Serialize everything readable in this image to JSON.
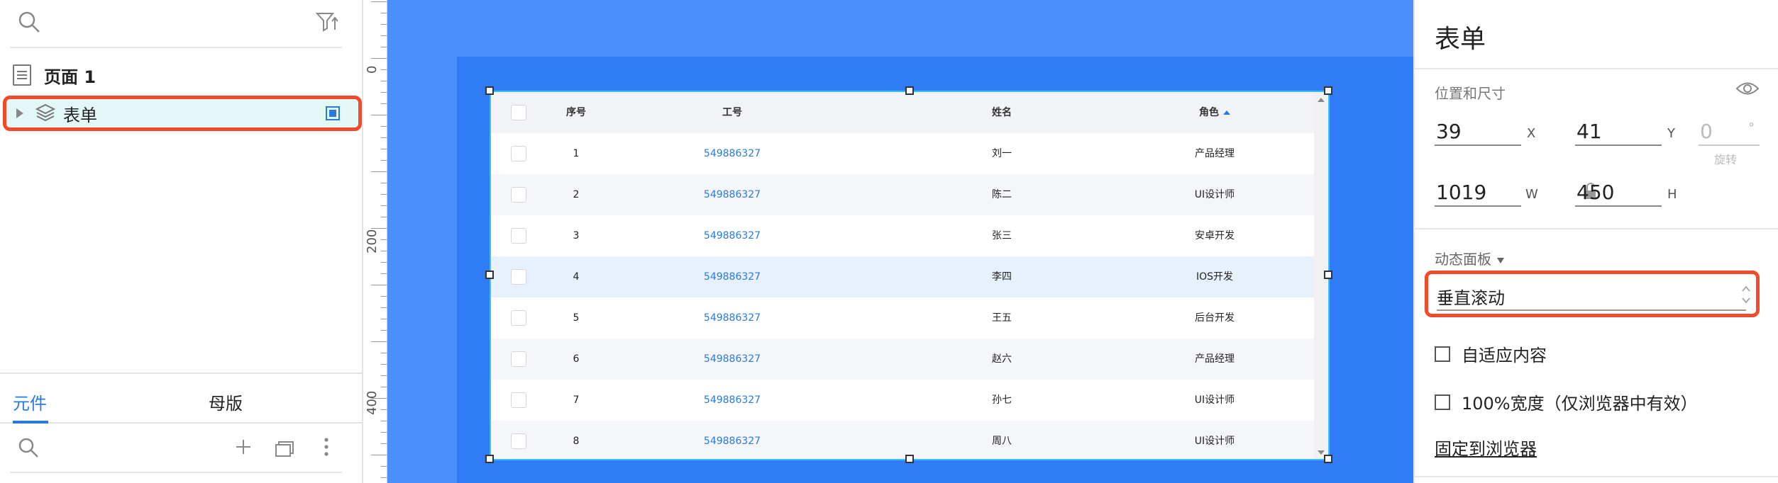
{
  "left_panel": {
    "page": {
      "label": "页面 1"
    },
    "layer": {
      "label": "表单"
    },
    "tabs": [
      {
        "label": "元件"
      },
      {
        "label": "母版"
      }
    ]
  },
  "ruler": {
    "labels": [
      "0",
      "200",
      "400"
    ]
  },
  "table": {
    "headers": {
      "seq": "序号",
      "id": "工号",
      "name": "姓名",
      "role": "角色"
    },
    "rows": [
      {
        "seq": "1",
        "id": "549886327",
        "name": "刘一",
        "role": "产品经理"
      },
      {
        "seq": "2",
        "id": "549886327",
        "name": "陈二",
        "role": "UI设计师"
      },
      {
        "seq": "3",
        "id": "549886327",
        "name": "张三",
        "role": "安卓开发"
      },
      {
        "seq": "4",
        "id": "549886327",
        "name": "李四",
        "role": "IOS开发"
      },
      {
        "seq": "5",
        "id": "549886327",
        "name": "王五",
        "role": "后台开发"
      },
      {
        "seq": "6",
        "id": "549886327",
        "name": "赵六",
        "role": "产品经理"
      },
      {
        "seq": "7",
        "id": "549886327",
        "name": "孙七",
        "role": "UI设计师"
      },
      {
        "seq": "8",
        "id": "549886327",
        "name": "周八",
        "role": "UI设计师"
      }
    ]
  },
  "right_panel": {
    "title": "表单",
    "position_size_label": "位置和尺寸",
    "x": {
      "value": "39",
      "axis": "X"
    },
    "y": {
      "value": "41",
      "axis": "Y"
    },
    "rotation": {
      "value": "0",
      "unit": "°",
      "label": "旋转"
    },
    "w": {
      "value": "1019",
      "axis": "W"
    },
    "h": {
      "value": "450",
      "axis": "H"
    },
    "dynamic_panel_label": "动态面板",
    "scroll_select": {
      "value": "垂直滚动"
    },
    "fit_content": {
      "label": "自适应内容"
    },
    "full_width": {
      "label": "100%宽度（仅浏览器中有效）"
    },
    "pin_link": "固定到浏览器"
  },
  "colors": {
    "accent": "#2a7ad9",
    "canvas": "#4b8ffb",
    "panel": "#2f7cf6",
    "highlight": "#f04b2c"
  }
}
